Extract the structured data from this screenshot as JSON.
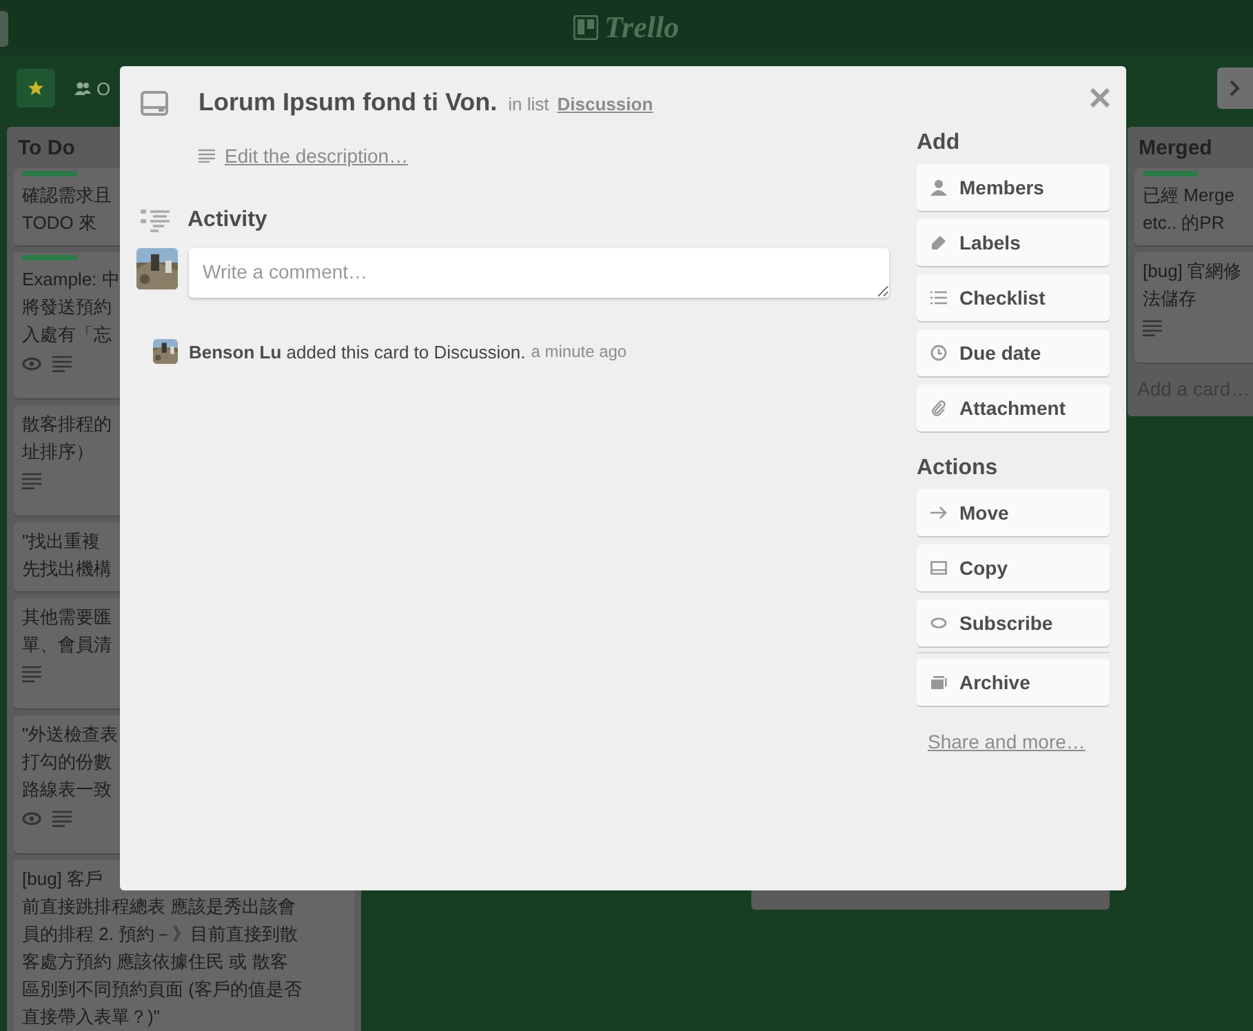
{
  "header": {
    "logo": "Trello"
  },
  "board": {
    "members_label": "O",
    "lists": [
      {
        "title": "To Do",
        "cards": [
          {
            "labels": [
              {
                "color": "#2b7a47"
              }
            ],
            "lines": [
              "確認需求且",
              "TODO 來"
            ],
            "watching": false,
            "has_description": false
          },
          {
            "labels": [
              {
                "color": "#2b7a47"
              }
            ],
            "lines": [
              "Example: 中",
              "將發送預約",
              "入處有「忘"
            ],
            "watching": true,
            "has_description": true
          },
          {
            "lines": [
              "散客排程的",
              "址排序）"
            ],
            "watching": false,
            "has_description": true
          },
          {
            "lines": [
              "\"找出重複",
              "先找出機構"
            ],
            "watching": false,
            "has_description": false
          },
          {
            "lines": [
              "其他需要匯",
              "單、會員清"
            ],
            "watching": false,
            "has_description": true
          },
          {
            "lines": [
              "\"外送檢查表",
              "打勾的份數",
              "路線表一致"
            ],
            "watching": true,
            "has_description": true
          },
          {
            "lines": [
              "[bug] 客戶",
              "前直接跳排程總表 應該是秀出該會",
              "員的排程 2. 預約－》目前直接到散",
              "客處方預約 應該依據住民 或 散客",
              "區別到不同預約頁面 (客戶的值是否",
              "直接帶入表單？)\""
            ],
            "watching": false,
            "has_description": false
          }
        ]
      },
      {
        "title": "Merged",
        "cards": [
          {
            "labels": [
              {
                "color": "#2b7a47"
              }
            ],
            "lines": [
              "已經 Merge",
              "etc.. 的PR"
            ],
            "watching": false,
            "has_description": false
          },
          {
            "lines": [
              "[bug] 官網修",
              "法儲存"
            ],
            "watching": false,
            "has_description": true
          }
        ],
        "add_card": "Add a card…"
      }
    ]
  },
  "card": {
    "title": "Lorum Ipsum fond ti Von.",
    "list_prefix": "in list",
    "list_name": "Discussion",
    "description_link": "Edit the description…",
    "activity_heading": "Activity",
    "comment_placeholder": "Write a comment…",
    "activity": [
      {
        "text": "**Benson Lu** added this card to Discussion.",
        "time": "a minute ago"
      }
    ],
    "sections": [
      {
        "heading": "Add",
        "buttons": [
          "Members",
          "Labels",
          "Checklist",
          "Due date",
          "Attachment"
        ]
      },
      {
        "heading": "Actions",
        "buttons": [
          "Move",
          "Copy",
          "Subscribe"
        ]
      },
      {
        "buttons": [
          "Archive"
        ]
      }
    ],
    "share_link": "Share and more…"
  }
}
